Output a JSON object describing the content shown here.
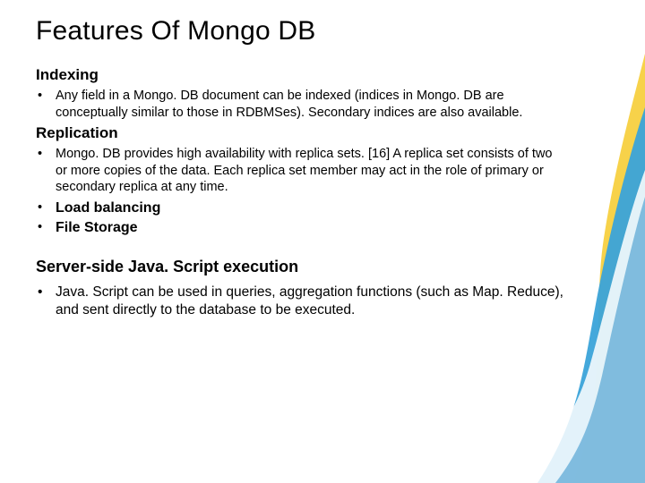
{
  "title": "Features Of Mongo DB",
  "sections": {
    "indexing": {
      "heading": "Indexing",
      "item": "Any field in a Mongo. DB document can be indexed (indices in Mongo. DB are conceptually similar to those in RDBMSes). Secondary indices are also available."
    },
    "replication": {
      "heading": "Replication",
      "item": "Mongo. DB provides high availability with replica sets. [16] A replica set consists of two or more copies of the data. Each replica set member may act in the role of primary or secondary replica at any time."
    },
    "extra": {
      "load_balancing": "Load balancing",
      "file_storage": "File Storage"
    },
    "serverjs": {
      "heading": "Server-side Java. Script execution",
      "item": "Java. Script can be used in queries, aggregation functions (such as Map. Reduce), and sent directly to the database to be executed."
    }
  }
}
